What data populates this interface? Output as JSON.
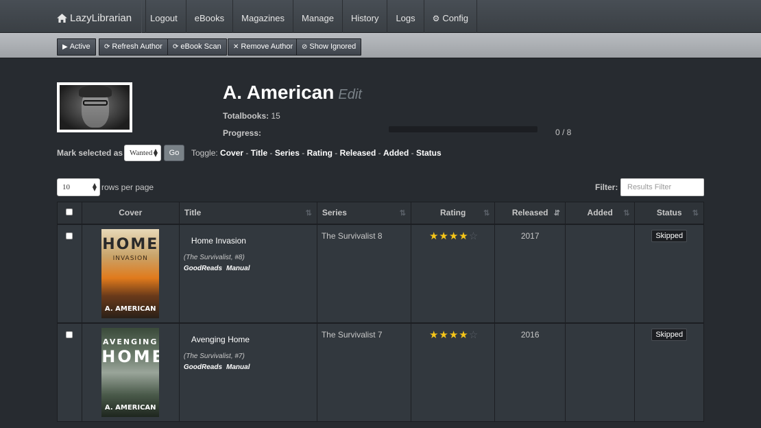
{
  "navbar": {
    "brand": "LazyLibrarian",
    "items": [
      {
        "label": "Logout"
      },
      {
        "label": "eBooks"
      },
      {
        "label": "Magazines"
      },
      {
        "label": "Manage"
      },
      {
        "label": "History"
      },
      {
        "label": "Logs"
      },
      {
        "label": "Config",
        "icon": "gear-icon"
      }
    ]
  },
  "toolbar": {
    "buttons": [
      {
        "label": "Active",
        "icon": "play-icon"
      },
      {
        "label": "Refresh Author",
        "icon": "refresh-icon"
      },
      {
        "label": "eBook Scan",
        "icon": "refresh-icon"
      },
      {
        "label": "Remove Author",
        "icon": "close-icon"
      },
      {
        "label": "Show Ignored",
        "icon": "ban-icon"
      }
    ]
  },
  "author": {
    "name": "A. American",
    "edit_label": "Edit",
    "totalbooks_label": "Totalbooks:",
    "totalbooks_value": "15",
    "progress_label": "Progress:",
    "progress_fraction": 0,
    "progress_text": "0 / 8"
  },
  "controls": {
    "mark_label": "Mark selected as",
    "mark_value": "Wanted",
    "go_label": "Go",
    "toggle_label": "Toggle:",
    "toggle_items": [
      "Cover",
      "Title",
      "Series",
      "Rating",
      "Released",
      "Added",
      "Status"
    ],
    "toggle_sep": " - ",
    "rows_value": "10",
    "rows_label": "rows per page",
    "filter_label": "Filter:",
    "filter_placeholder": "Results Filter"
  },
  "table": {
    "headers": [
      "Cover",
      "Title",
      "Series",
      "Rating",
      "Released",
      "Added",
      "Status"
    ],
    "rows": [
      {
        "cover": {
          "line1": "HOME",
          "line2": "INVASION",
          "author": "A. AMERICAN",
          "palette": "fire"
        },
        "title": "Home Invasion",
        "series_note": "(The Survivalist, #8)",
        "links": [
          "GoodReads",
          "Manual"
        ],
        "series": "The Survivalist 8",
        "rating": 4,
        "rating_max": 5,
        "released": "2017",
        "added": "",
        "status": "Skipped"
      },
      {
        "cover": {
          "line1": "AVENGING",
          "line2": "HOME",
          "author": "A. AMERICAN",
          "palette": "storm"
        },
        "title": "Avenging Home",
        "series_note": "(The Survivalist, #7)",
        "links": [
          "GoodReads",
          "Manual"
        ],
        "series": "The Survivalist 7",
        "rating": 4,
        "rating_max": 5,
        "released": "2016",
        "added": "",
        "status": "Skipped"
      }
    ]
  }
}
